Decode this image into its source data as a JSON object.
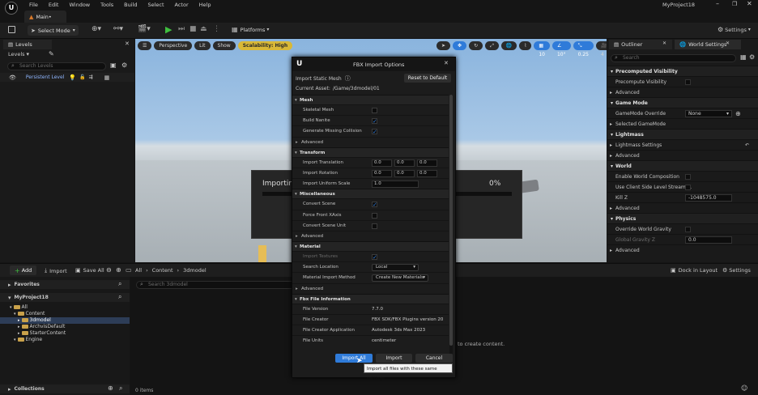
{
  "titlebar": {
    "menu": [
      "File",
      "Edit",
      "Window",
      "Tools",
      "Build",
      "Select",
      "Actor",
      "Help"
    ],
    "project": "MyProject18"
  },
  "tab": {
    "label": "Main•"
  },
  "toolbar": {
    "select_mode": "Select Mode",
    "platforms": "Platforms",
    "settings": "Settings"
  },
  "levels_panel": {
    "tab": "Levels",
    "dropdown": "Levels",
    "search_placeholder": "Search Levels",
    "persistent_level": "Persistent Level"
  },
  "viewport": {
    "perspective": "Perspective",
    "lit": "Lit",
    "show": "Show",
    "scalability": "Scalability: High",
    "grid": "10",
    "angle": "10°",
    "scale": "0.25",
    "camera": "4"
  },
  "outliner": {
    "tabs": [
      "Outliner",
      "World Settings"
    ],
    "search_placeholder": "Search",
    "rows": [
      {
        "kind": "sec",
        "label": "Precomputed Visibility"
      },
      {
        "kind": "row",
        "label": "Precompute Visibility",
        "check": true
      },
      {
        "kind": "adv",
        "label": "Advanced"
      },
      {
        "kind": "sec",
        "label": "Game Mode"
      },
      {
        "kind": "row",
        "label": "GameMode Override",
        "select": "None"
      },
      {
        "kind": "adv",
        "label": "Selected GameMode"
      },
      {
        "kind": "sec",
        "label": "Lightmass"
      },
      {
        "kind": "adv",
        "label": "Lightmass Settings"
      },
      {
        "kind": "adv",
        "label": "Advanced"
      },
      {
        "kind": "sec",
        "label": "World"
      },
      {
        "kind": "row",
        "label": "Enable World Composition",
        "check": true
      },
      {
        "kind": "row",
        "label": "Use Client Side Level Streami...",
        "check": true
      },
      {
        "kind": "row",
        "label": "Kill Z",
        "field": "-1048575.0"
      },
      {
        "kind": "adv",
        "label": "Advanced"
      },
      {
        "kind": "sec",
        "label": "Physics"
      },
      {
        "kind": "row",
        "label": "Override World Gravity",
        "check": true
      },
      {
        "kind": "dim",
        "label": "Global Gravity Z",
        "field": "0.0"
      },
      {
        "kind": "adv",
        "label": "Advanced"
      }
    ]
  },
  "importing": {
    "label": "Importing",
    "percent": "0%",
    "progress": 0
  },
  "fbx": {
    "title": "FBX Import Options",
    "subtitle": "Import Static Mesh",
    "reset": "Reset to Default",
    "current_asset_label": "Current Asset:",
    "current_asset": "/Game/3dmodel/01",
    "rows": [
      {
        "kind": "sec",
        "label": "Mesh"
      },
      {
        "kind": "row",
        "label": "Skeletal Mesh",
        "check": false
      },
      {
        "kind": "row",
        "label": "Build Nanite",
        "check": true
      },
      {
        "kind": "row",
        "label": "Generate Missing Collision",
        "check": true
      },
      {
        "kind": "adv",
        "label": "Advanced"
      },
      {
        "kind": "sec",
        "label": "Transform"
      },
      {
        "kind": "vec",
        "label": "Import Translation",
        "values": [
          "0.0",
          "0.0",
          "0.0"
        ]
      },
      {
        "kind": "vec",
        "label": "Import Rotation",
        "values": [
          "0.0",
          "0.0",
          "0.0"
        ]
      },
      {
        "kind": "num",
        "label": "Import Uniform Scale",
        "value": "1.0"
      },
      {
        "kind": "sec",
        "label": "Miscellaneous"
      },
      {
        "kind": "row",
        "label": "Convert Scene",
        "check": true
      },
      {
        "kind": "row",
        "label": "Force Front XAxis",
        "check": false
      },
      {
        "kind": "row",
        "label": "Convert Scene Unit",
        "check": false
      },
      {
        "kind": "adv",
        "label": "Advanced"
      },
      {
        "kind": "sec",
        "label": "Material"
      },
      {
        "kind": "dimrow",
        "label": "Import Textures",
        "check": true
      },
      {
        "kind": "select",
        "label": "Search Location",
        "value": "Local"
      },
      {
        "kind": "select",
        "label": "Material Import Method",
        "value": "Create New Materials"
      },
      {
        "kind": "adv",
        "label": "Advanced"
      },
      {
        "kind": "sec",
        "label": "Fbx File Information"
      },
      {
        "kind": "text",
        "label": "File Version",
        "value": "7.7.0"
      },
      {
        "kind": "text",
        "label": "File Creator",
        "value": "FBX SDK/FBX Plugins version 20"
      },
      {
        "kind": "text",
        "label": "File Creator Application",
        "value": "Autodesk 3ds Max 2023"
      },
      {
        "kind": "text",
        "label": "File Units",
        "value": "centimeter"
      }
    ],
    "import_all": "Import All",
    "import": "Import",
    "cancel": "Cancel",
    "tooltip": "Import all files with these same settings"
  },
  "content_bar": {
    "add": "Add",
    "import": "Import",
    "save_all": "Save All",
    "path": [
      "All",
      "Content",
      "3dmodel"
    ],
    "dock": "Dock in Layout",
    "settings": "Settings"
  },
  "sources": {
    "favorites": "Favorites",
    "project": "MyProject18",
    "tree": [
      {
        "label": "All",
        "indent": 0
      },
      {
        "label": "Content",
        "indent": 1
      },
      {
        "label": "3dmodel",
        "indent": 2,
        "selected": true
      },
      {
        "label": "ArchvisDefault",
        "indent": 2
      },
      {
        "label": "StarterContent",
        "indent": 2
      },
      {
        "label": "Engine",
        "indent": 1
      }
    ],
    "collections": "Collections"
  },
  "assets": {
    "search_placeholder": "Search 3dmodel",
    "empty_hint": "to create content.",
    "count": "0 items"
  }
}
